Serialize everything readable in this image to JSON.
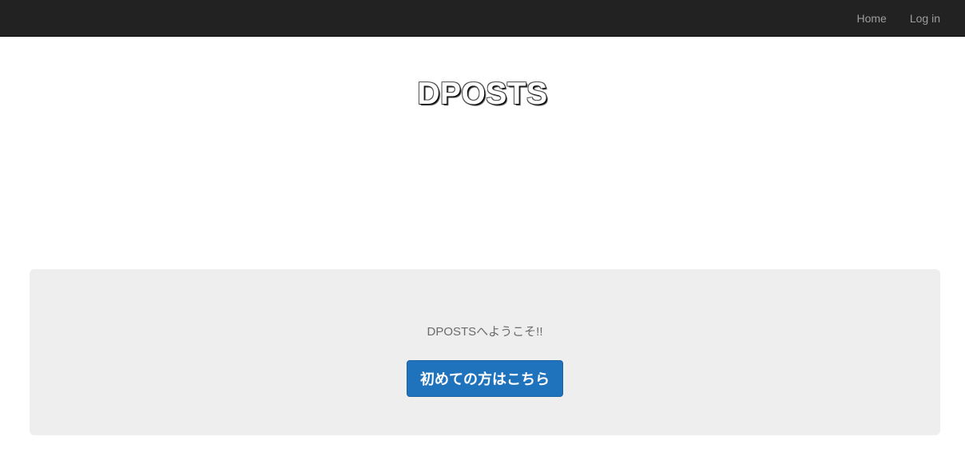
{
  "navbar": {
    "links": [
      {
        "label": "Home"
      },
      {
        "label": "Log in"
      }
    ],
    "background_color": "#222222",
    "link_color": "#9d9d9d"
  },
  "header": {
    "title": "DPOSTS"
  },
  "jumbotron": {
    "welcome_text": "DPOSTSへようこそ!!",
    "cta_label": "初めての方はこちら",
    "background_color": "#eeeeee",
    "cta_color": "#1f73bd"
  }
}
